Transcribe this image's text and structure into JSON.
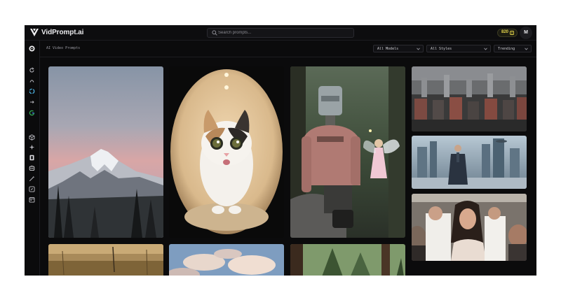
{
  "app": {
    "brand": "VidPrompt.ai"
  },
  "header": {
    "search_placeholder": "Search prompts...",
    "credits": "820",
    "avatar_initial": "M"
  },
  "toolbar": {
    "section_title": "AI Video Prompts",
    "filter_models": "All Models",
    "filter_styles": "All Styles",
    "sort": "Trending"
  },
  "sidebar": {
    "icons": [
      "home-icon",
      "reload-icon",
      "openai-icon",
      "arrow-icon",
      "google-icon",
      "cube-icon",
      "sparkle-icon",
      "film-icon",
      "robot-icon",
      "wand-icon",
      "compass-icon",
      "calendar-icon"
    ]
  },
  "gallery": {
    "items": [
      "snowy-mountain",
      "kitten-fisheye",
      "robot-and-fairy",
      "medieval-army",
      "sci-fi-city-man",
      "woman-at-event",
      "dry-grass-field",
      "clouds-sky",
      "pine-forest"
    ]
  },
  "colors": {
    "background": "#0b0b0c",
    "accent": "#e7d84b",
    "border": "#2a2a30"
  }
}
